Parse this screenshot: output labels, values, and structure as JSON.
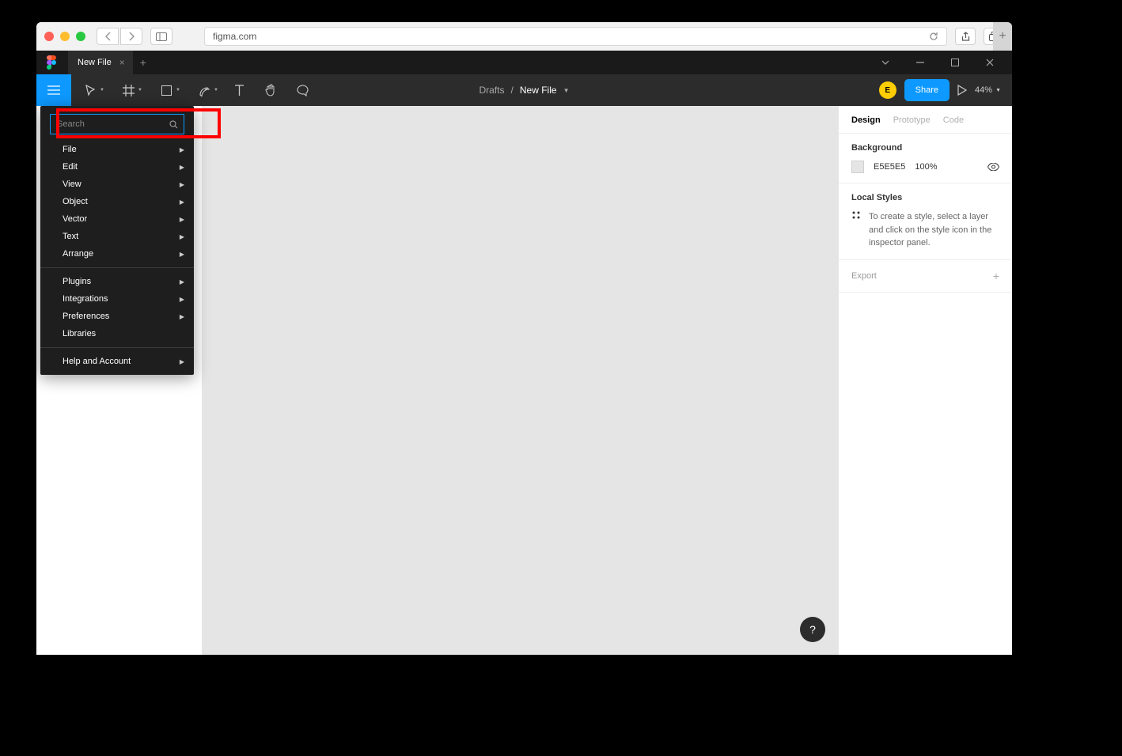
{
  "browser": {
    "url": "figma.com"
  },
  "tabs": {
    "active": "New File"
  },
  "toolbar": {
    "breadcrumb_parent": "Drafts",
    "breadcrumb_current": "New File",
    "share_label": "Share",
    "avatar_letter": "E",
    "zoom": "44%"
  },
  "dropdown": {
    "search_placeholder": "Search",
    "group1": {
      "file": "File",
      "edit": "Edit",
      "view": "View",
      "object": "Object",
      "vector": "Vector",
      "text": "Text",
      "arrange": "Arrange"
    },
    "group2": {
      "plugins": "Plugins",
      "integrations": "Integrations",
      "preferences": "Preferences",
      "libraries": "Libraries"
    },
    "group3": {
      "help": "Help and Account"
    }
  },
  "right_panel": {
    "tabs": {
      "design": "Design",
      "prototype": "Prototype",
      "code": "Code"
    },
    "background": {
      "title": "Background",
      "hex": "E5E5E5",
      "opacity": "100%"
    },
    "local_styles": {
      "title": "Local Styles",
      "hint": "To create a style, select a layer and click on the style icon in the inspector panel."
    },
    "export": "Export"
  }
}
